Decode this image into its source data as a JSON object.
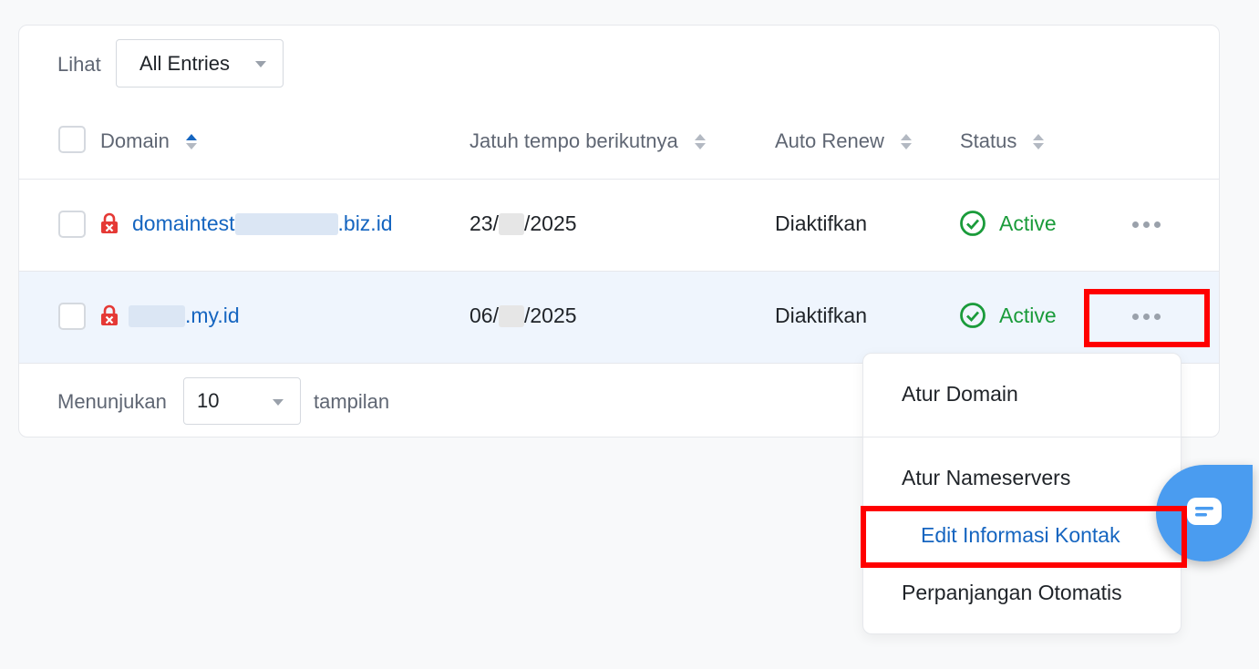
{
  "toolbar": {
    "view_label": "Lihat",
    "view_selected": "All Entries"
  },
  "table": {
    "columns": [
      "Domain",
      "Jatuh tempo berikutnya",
      "Auto Renew",
      "Status"
    ],
    "rows": [
      {
        "domain_prefix": "domaintest",
        "domain_suffix": ".biz.id",
        "due_prefix": "23/",
        "due_suffix": "/2025",
        "auto_renew": "Diaktifkan",
        "status": "Active"
      },
      {
        "domain_prefix": "",
        "domain_suffix": ".my.id",
        "due_prefix": "06/",
        "due_suffix": "/2025",
        "auto_renew": "Diaktifkan",
        "status": "Active"
      }
    ]
  },
  "footer": {
    "showing_label": "Menunjukan",
    "page_size": "10",
    "suffix_label": "tampilan"
  },
  "menu": {
    "items": [
      "Atur Domain",
      "Atur Nameservers",
      "Edit Informasi Kontak",
      "Perpanjangan Otomatis"
    ]
  },
  "colors": {
    "link": "#1565c0",
    "active": "#1a9b3a",
    "lock": "#e53935",
    "highlight": "#ff0000",
    "chat": "#4a9cf0"
  },
  "icons": [
    "lock-icon",
    "check-circle-icon",
    "more-dots-icon",
    "sort-icon",
    "chevron-down-icon",
    "chat-icon"
  ]
}
